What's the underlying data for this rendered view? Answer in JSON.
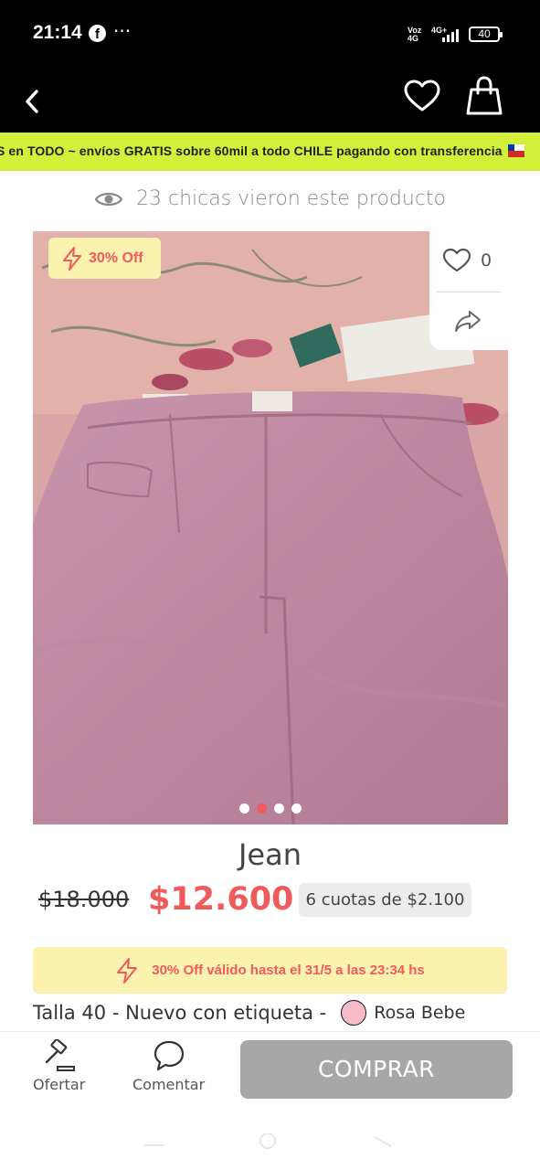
{
  "status_bar": {
    "time": "21:14",
    "fb_icon": "f",
    "more": "···",
    "net_top": "Vo",
    "net_bottom": "4G",
    "net2_top": "4G+",
    "battery": "40"
  },
  "header": {
    "back_icon": "chevron-left-icon",
    "favorite_icon": "heart-icon",
    "cart_icon": "shopping-bag-icon"
  },
  "promo_banner": {
    "text": "S en TODO ~ envíos GRATIS sobre 60mil a todo CHILE pagando con transferencia"
  },
  "views": {
    "text": "23 chicas vieron este producto"
  },
  "product_image": {
    "discount_label": "30% Off",
    "likes": "0",
    "carousel_total": 4,
    "carousel_active": 2
  },
  "product": {
    "title": "Jean",
    "old_price": "$18.000",
    "new_price": "$12.600",
    "installments": "6 cuotas de $2.100"
  },
  "offer_banner": {
    "text": "30% Off válido hasta el 31/5 a las 23:34 hs"
  },
  "details": {
    "size_condition": "Talla 40 - Nuevo con etiqueta -",
    "color_name": "Rosa Bebe",
    "color_hex": "#f7bcc8"
  },
  "bottom_bar": {
    "offer_label": "Ofertar",
    "comment_label": "Comentar",
    "buy_label": "COMPRAR"
  },
  "colors": {
    "accent": "#ef5b5b",
    "promo_bg": "#d2f03a",
    "highlight_bg": "#fbf2b0",
    "buy_disabled": "#a7a7a7"
  }
}
